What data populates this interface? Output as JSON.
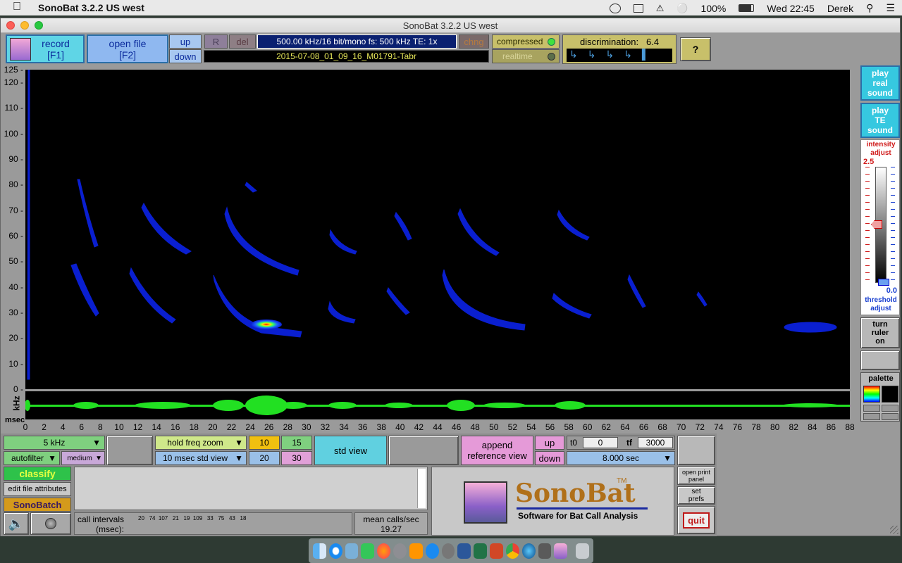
{
  "menubar": {
    "app_name": "SonoBat 3.2.2 US west",
    "battery": "100%",
    "clock": "Wed 22:45",
    "user": "Derek"
  },
  "window": {
    "title": "SonoBat 3.2.2 US west"
  },
  "toolbar": {
    "record": "record\n[F1]",
    "record_line1": "record",
    "record_line2": "[F1]",
    "open_line1": "open file",
    "open_line2": "[F2]",
    "up": "up",
    "down": "down",
    "r": "R",
    "del": "del",
    "file_info": "500.00 kHz/16 bit/mono   fs: 500 kHz   TE:  1x",
    "filename": "2015-07-08_01_09_16_M01791-Tabr",
    "chng": "chng",
    "compressed": "compressed",
    "realtime": "realtime",
    "discrimination_label": "discrimination:",
    "discrimination_value": "6.4",
    "help": "?"
  },
  "right_panel": {
    "play_real_1": "play",
    "play_real_2": "real",
    "play_real_3": "sound",
    "play_te_1": "play",
    "play_te_2": "TE",
    "play_te_3": "sound",
    "intensity_1": "intensity",
    "intensity_2": "adjust",
    "intensity_value": "2.5",
    "threshold_value": "0.0",
    "threshold_1": "threshold",
    "threshold_2": "adjust",
    "ruler_1": "turn",
    "ruler_2": "ruler",
    "ruler_3": "on",
    "palette": "palette"
  },
  "axes": {
    "y_unit": "kHz",
    "x_unit": "msec",
    "y_ticks": [
      "125",
      "120",
      "110",
      "100",
      "90",
      "80",
      "70",
      "60",
      "50",
      "40",
      "30",
      "20",
      "10",
      "0"
    ],
    "x_ticks": [
      "0",
      "2",
      "4",
      "6",
      "8",
      "10",
      "12",
      "14",
      "16",
      "18",
      "20",
      "22",
      "24",
      "26",
      "28",
      "30",
      "32",
      "34",
      "36",
      "38",
      "40",
      "42",
      "44",
      "46",
      "48",
      "50",
      "52",
      "54",
      "56",
      "58",
      "60",
      "62",
      "64",
      "66",
      "68",
      "70",
      "72",
      "74",
      "76",
      "78",
      "80",
      "82",
      "84",
      "86",
      "88"
    ]
  },
  "bottom": {
    "filter_select": "5 kHz",
    "autofilter": "autofilter",
    "medium": "medium",
    "hold_freq_zoom": "hold freq zoom",
    "std_view_select": "10 msec std view",
    "z10": "10",
    "z15": "15",
    "z20": "20",
    "z30": "30",
    "std_view": "std view",
    "append_1": "append",
    "append_2": "reference view",
    "up": "up",
    "down": "down",
    "t0_label": "t0",
    "t0_value": "0",
    "tf_label": "tf",
    "tf_value": "3000",
    "duration": "8.000 sec",
    "classify": "classify",
    "edit_attrs": "edit file attributes",
    "sonobatch": "SonoBatch",
    "call_intervals_1": "call intervals",
    "call_intervals_2": "(msec):",
    "call_interval_values": "20   74  107   21   19  109   33   75   43   18",
    "mean_calls_label": "mean calls/sec",
    "mean_calls_value": "19.27",
    "logo_text": "SonoBat",
    "tm": "TM",
    "logo_sub": "Software for Bat Call Analysis",
    "open_print_1": "open print",
    "open_print_2": "panel",
    "set_prefs_1": "set",
    "set_prefs_2": "prefs",
    "quit": "quit"
  },
  "colors": {
    "cyan_panel": "#5fd5e6",
    "blue_button": "#8fb8f0",
    "green_button": "#2ec24a",
    "gold_button": "#d49a1c",
    "pink_button": "#e59ad8",
    "spectro_bg": "#000000",
    "signal_blue": "#0a1fd0",
    "waveform_green": "#22e022"
  }
}
